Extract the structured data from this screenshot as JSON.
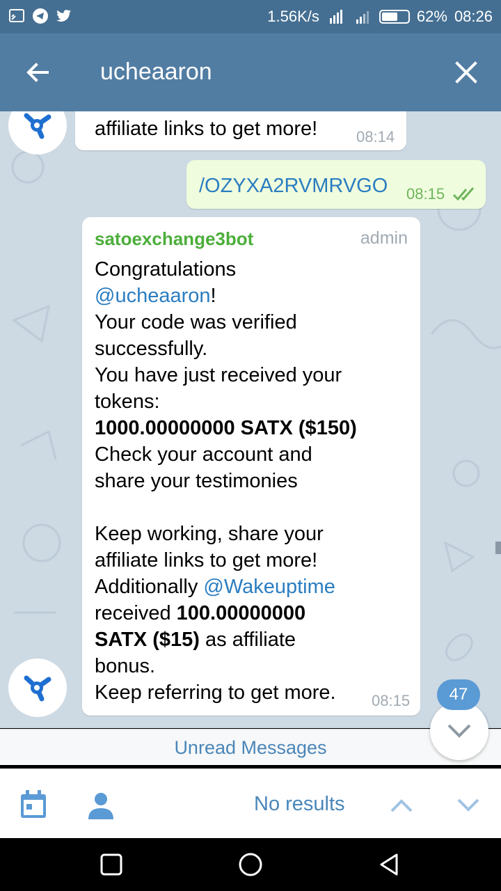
{
  "status_bar": {
    "net_speed": "1.56K/s",
    "battery_percent": "62%",
    "battery_level": 0.62,
    "time": "08:26"
  },
  "header": {
    "title": "ucheaaron"
  },
  "messages": [
    {
      "partial_text": "affiliate links to get more!",
      "time": "08:14"
    },
    {
      "text": "/OZYXA2RVMRVGO",
      "time": "08:15"
    },
    {
      "sender": "satoexchange3bot",
      "role": "admin",
      "line1": "Congratulations",
      "mention1": "@ucheaaron",
      "after_mention1": "!",
      "line2": "Your code was verified",
      "line3": "successfully.",
      "line4": "You have just received your",
      "line5": "tokens:",
      "amount": "1000.00000000 SATX ($150)",
      "line6": "Check your account and",
      "line7": "share your testimonies",
      "line8": "Keep working, share your",
      "line9": "affiliate links to get more!",
      "additionally": "Additionally ",
      "mention2": "@Wakeuptime",
      "received": "received ",
      "bonus_amount": "100.00000000",
      "bonus_satx": "SATX ($15)",
      "as_affiliate": " as affiliate",
      "bonus_word": "bonus.",
      "line_last": "Keep referring to get more.",
      "time": "08:15"
    }
  ],
  "unread_bar": "Unread Messages",
  "unread_count": "47",
  "search_bar": {
    "no_results": "No results"
  },
  "colors": {
    "status_bar": "#456f92",
    "app_bar": "#527da3",
    "chat_bg": "#cdd9e3",
    "sender_name": "#4cae3a",
    "link": "#2b7dc0",
    "outgoing_bubble": "#effdde",
    "bot_avatar_blue": "#1f6fd1"
  },
  "icons": {
    "status_left": [
      "screencast-icon",
      "telegram-icon",
      "twitter-icon"
    ],
    "bot_avatar": "satoexchange-logo"
  }
}
